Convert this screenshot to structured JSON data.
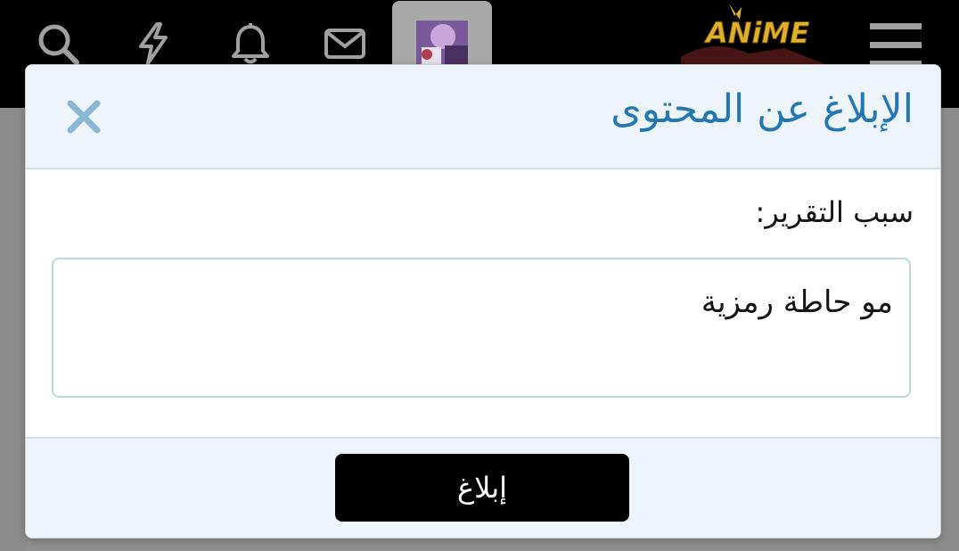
{
  "topbar": {
    "icons": [
      "search-icon",
      "lightning-icon",
      "bell-icon",
      "envelope-icon",
      "avatar",
      "menu-icon"
    ],
    "logo_text": "ANiME"
  },
  "modal": {
    "title": "الإبلاغ عن المحتوى",
    "close_icon": "close-icon",
    "field_label": "سبب التقرير:",
    "reason_value": "مو حاطة رمزية",
    "submit_label": "إبلاغ"
  },
  "colors": {
    "topbar_bg": "#000000",
    "header_bg": "#edf4fb",
    "title_color": "#2577b1",
    "close_color": "#8bb7d6",
    "input_border": "#b8d8e8",
    "button_bg": "#000000",
    "button_text": "#ffffff"
  }
}
